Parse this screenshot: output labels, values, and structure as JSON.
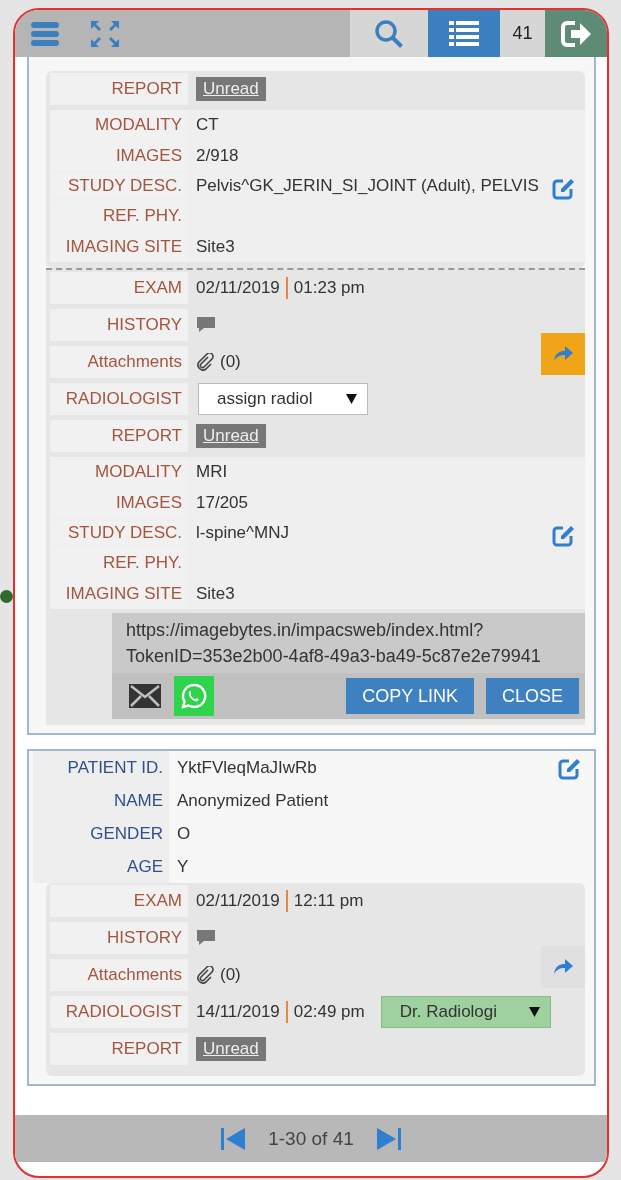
{
  "toolbar": {
    "count": "41"
  },
  "cards": [
    {
      "exams": [
        {
          "rows": [
            {
              "kind": "badge",
              "label": "REPORT",
              "value": "Unread"
            },
            {
              "kind": "info",
              "label": "MODALITY",
              "value": "CT"
            },
            {
              "kind": "info",
              "label": "IMAGES",
              "value": "2/918"
            },
            {
              "kind": "desc",
              "label": "STUDY DESC.",
              "value": "Pelvis^GK_JERIN_SI_JOINT (Adult), PELVIS"
            },
            {
              "kind": "info",
              "label": "REF. PHY."
            },
            {
              "kind": "info",
              "label": "IMAGING SITE",
              "value": "Site3"
            }
          ]
        },
        {
          "share_active": true,
          "rows": [
            {
              "kind": "datetime",
              "label": "EXAM",
              "date": "02/11/2019",
              "time": "01:23 pm"
            },
            {
              "kind": "history",
              "label": "HISTORY"
            },
            {
              "kind": "attach",
              "label": "Attachments",
              "value": "(0)"
            },
            {
              "kind": "select",
              "label": "RADIOLOGIST",
              "value": "assign radiol"
            },
            {
              "kind": "badge",
              "label": "REPORT",
              "value": "Unread"
            },
            {
              "kind": "info",
              "label": "MODALITY",
              "value": "MRI"
            },
            {
              "kind": "info",
              "label": "IMAGES",
              "value": "17/205"
            },
            {
              "kind": "desc",
              "label": "STUDY DESC.",
              "value": "l-spine^MNJ"
            },
            {
              "kind": "info",
              "label": "REF. PHY."
            },
            {
              "kind": "info",
              "label": "IMAGING SITE",
              "value": "Site3"
            }
          ],
          "share": {
            "url": "https://imagebytes.in/impacsweb/index.html?TokenID=353e2b00-4af8-49a3-ba49-5c87e2e79941",
            "copy": "COPY LINK",
            "close": "CLOSE"
          }
        }
      ]
    },
    {
      "patient": [
        {
          "label": "PATIENT ID.",
          "value": "YktFVleqMaJIwRb"
        },
        {
          "label": "NAME",
          "value": "Anonymized Patient"
        },
        {
          "label": "GENDER",
          "value": "O"
        },
        {
          "label": "AGE",
          "value": "Y"
        }
      ],
      "exams": [
        {
          "share_active": false,
          "rows": [
            {
              "kind": "datetime",
              "label": "EXAM",
              "date": "02/11/2019",
              "time": "12:11 pm"
            },
            {
              "kind": "history",
              "label": "HISTORY"
            },
            {
              "kind": "attach",
              "label": "Attachments",
              "value": "(0)"
            },
            {
              "kind": "assigned",
              "label": "RADIOLOGIST",
              "date": "14/11/2019",
              "time": "02:49 pm",
              "value": "Dr. Radiologi"
            },
            {
              "kind": "badge",
              "label": "REPORT",
              "value": "Unread"
            }
          ]
        }
      ]
    }
  ],
  "pager": {
    "range": "1-30 of 41"
  }
}
